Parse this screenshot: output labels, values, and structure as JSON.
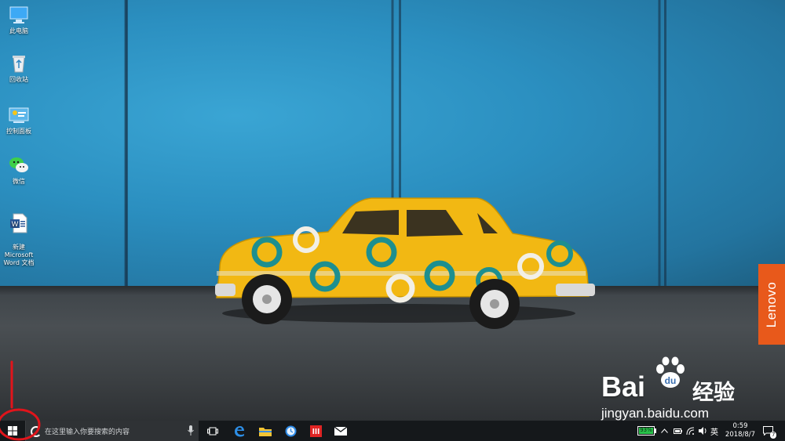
{
  "desktop": {
    "icons": [
      {
        "label": "此电脑",
        "icon": "this-pc-icon"
      },
      {
        "label": "回收站",
        "icon": "recycle-bin-icon"
      },
      {
        "label": "控制面板",
        "icon": "control-panel-icon"
      },
      {
        "label": "微信",
        "icon": "wechat-icon"
      },
      {
        "label": "新建\nMicrosoft\nWord 文档",
        "icon": "word-document-icon"
      }
    ],
    "lenovo_label": "Lenovo",
    "watermark": {
      "brand": "Bai",
      "brand_suffix": "du",
      "cn": "经验",
      "url": "jingyan.baidu.com"
    }
  },
  "taskbar": {
    "start_icon": "windows-start-icon",
    "search_placeholder": "在这里输入你要搜索的内容",
    "apps": [
      "task-view-icon",
      "edge-browser-icon",
      "file-explorer-icon",
      "clock-app-icon",
      "red-app-icon",
      "mail-icon"
    ],
    "battery_percent": "93%",
    "ime": "英",
    "time": "0:59",
    "date": "2018/8/7",
    "notification_count": "7"
  },
  "colors": {
    "wall": "#2b8fc0",
    "car": "#f2b813",
    "car_rings": "#1d8f8f",
    "lenovo": "#e8591b",
    "taskbar": "#15181b",
    "annotation": "#e0141b"
  }
}
